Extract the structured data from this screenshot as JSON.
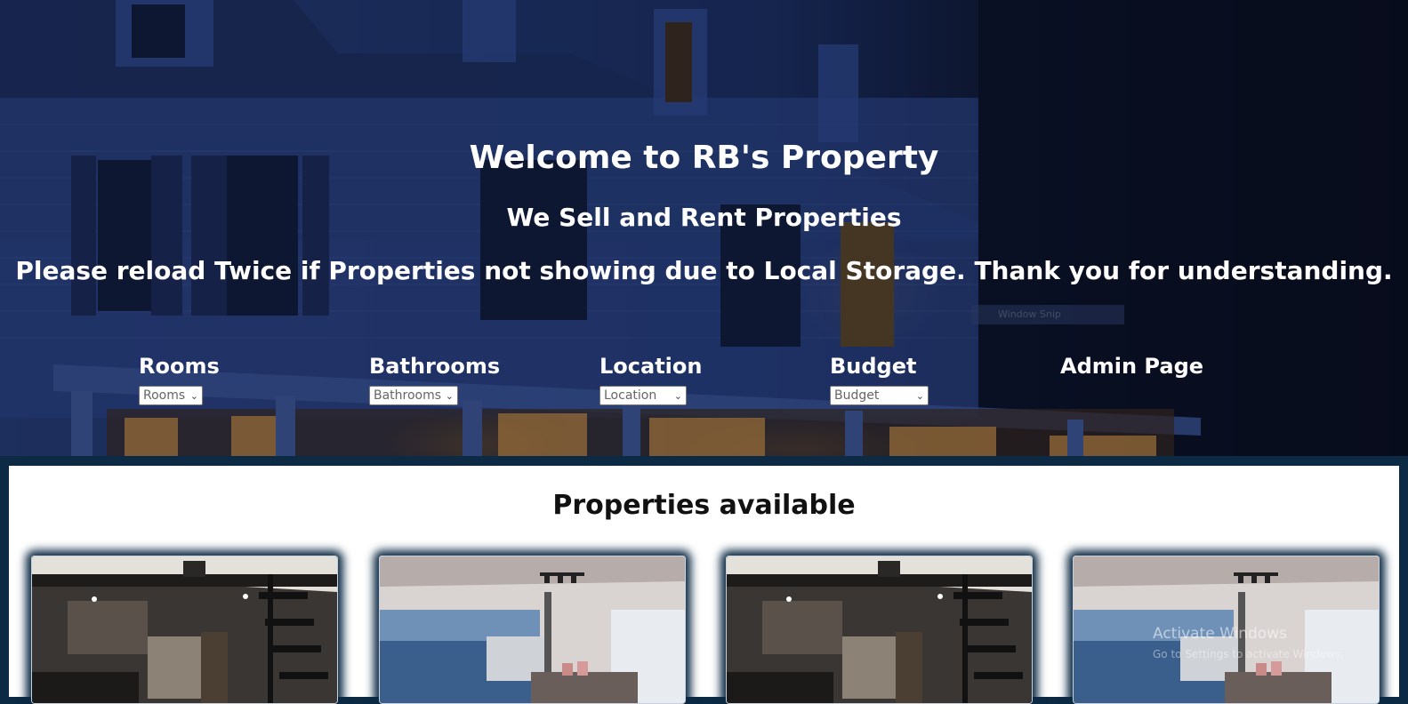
{
  "hero": {
    "title": "Welcome to RB's Property",
    "subtitle": "We Sell and Rent Properties",
    "notice": "Please reload Twice if Properties not showing due to Local Storage. Thank you for understanding."
  },
  "filters": [
    {
      "label": "Rooms",
      "select_value": "Rooms"
    },
    {
      "label": "Bathrooms",
      "select_value": "Bathrooms"
    },
    {
      "label": "Location",
      "select_value": "Location"
    },
    {
      "label": "Budget",
      "select_value": "Budget"
    }
  ],
  "admin_link": "Admin Page",
  "overlay": {
    "window_snip": "Window Snip",
    "activate_title": "Activate Windows",
    "activate_sub": "Go to Settings to activate Windows."
  },
  "properties": {
    "heading": "Properties available",
    "cards": [
      {
        "image": "living-room-loft-photo"
      },
      {
        "image": "ocean-view-living-room-photo"
      },
      {
        "image": "living-room-loft-photo"
      },
      {
        "image": "ocean-view-living-room-photo"
      }
    ]
  },
  "colors": {
    "frame": "#0c2a44",
    "hero_tint": "#1f3366",
    "text": "#ffffff"
  }
}
